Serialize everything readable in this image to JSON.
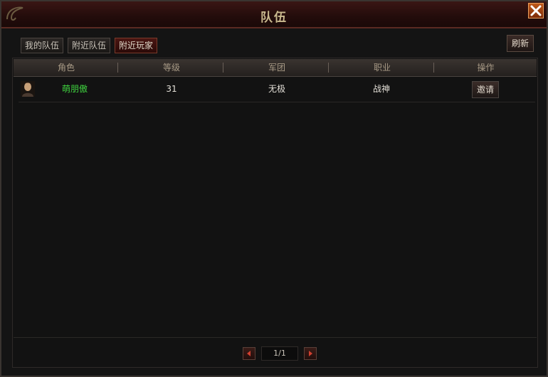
{
  "window": {
    "title": "队伍"
  },
  "tabs": [
    {
      "label": "我的队伍",
      "active": false
    },
    {
      "label": "附近队伍",
      "active": false
    },
    {
      "label": "附近玩家",
      "active": true
    }
  ],
  "toolbar": {
    "refresh_label": "刷新"
  },
  "table": {
    "headers": [
      "角色",
      "等级",
      "军团",
      "职业",
      "操作"
    ],
    "rows": [
      {
        "name": "萌朋傲",
        "level": "31",
        "legion": "无极",
        "class": "战神",
        "action": "邀请"
      }
    ]
  },
  "pagination": {
    "text": "1/1"
  },
  "colors": {
    "accent": "#5a2a22",
    "name_green": "#3fd23f",
    "title_gold": "#c9b98e"
  }
}
